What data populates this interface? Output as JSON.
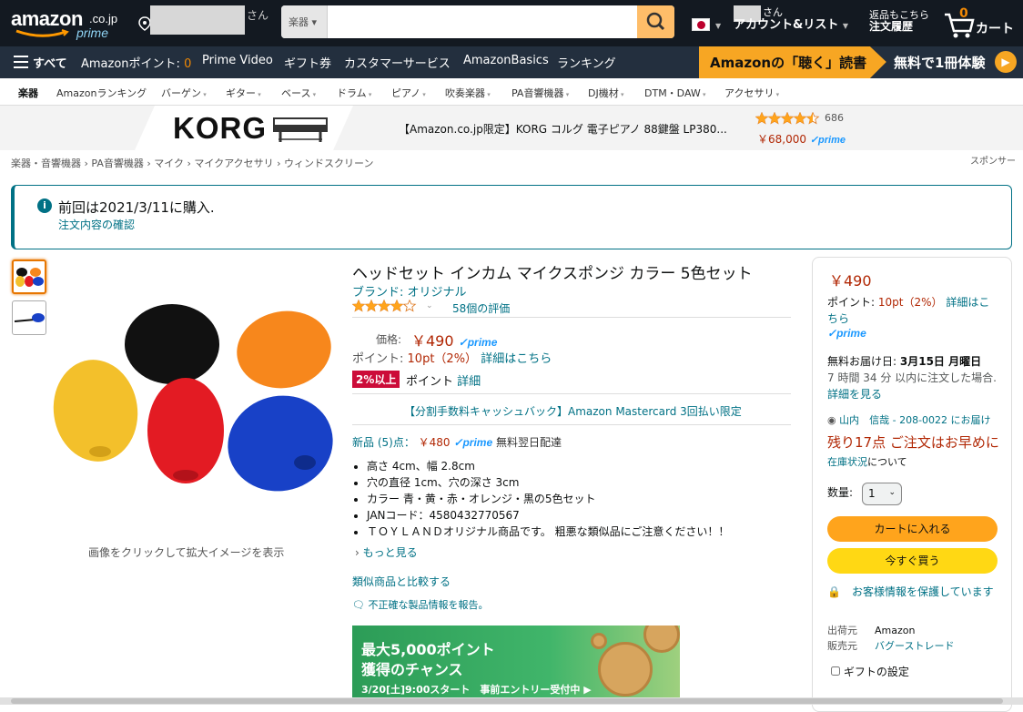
{
  "header": {
    "logo_word": "amazon",
    "logo_domain": ".co.jp",
    "logo_sub": "prime",
    "greeting_suffix": "さん",
    "search_category": "楽器",
    "account_greeting": "さん",
    "account_label": "アカウント&リスト",
    "orders_line1": "返品もこちら",
    "orders_line2": "注文履歴",
    "cart_count": "0",
    "cart_label": "カート"
  },
  "nav": {
    "all": "すべて",
    "points_label": "Amazonポイント:",
    "points_value": "0",
    "items": [
      "Prime Video",
      "ギフト券",
      "カスタマーサービス",
      "AmazonBasics",
      "ランキング"
    ],
    "audible_left": "Amazonの「聴く」読書",
    "audible_right": "無料で1冊体験"
  },
  "subnav": [
    "楽器",
    "Amazonランキング",
    "バーゲン",
    "ギター",
    "ベース",
    "ドラム",
    "ピアノ",
    "吹奏楽器",
    "PA音響機器",
    "DJ機材",
    "DTM・DAW",
    "アクセサリ"
  ],
  "ad": {
    "brand": "KORG",
    "title": "【Amazon.co.jp限定】KORG コルグ 電子ピアノ 88鍵盤 LP380...",
    "reviews": "686",
    "price": "￥68,000",
    "prime": "prime",
    "rating": 4.5
  },
  "breadcrumb": "楽器・音響機器 › PA音響機器 › マイク › マイクアクセサリ › ウィンドスクリーン",
  "sponsor": "スポンサー",
  "notice": {
    "title": "前回は2021/3/11に購入.",
    "link": "注文内容の確認"
  },
  "image_caption": "画像をクリックして拡大イメージを表示",
  "product": {
    "title": "ヘッドセット インカム マイクスポンジ カラー 5色セット",
    "brand": "ブランド: オリジナル",
    "rating": 4.0,
    "ratings_count": "58個の評価",
    "price_label": "価格:",
    "price": "￥490",
    "prime": "prime",
    "points_label": "ポイント:",
    "points_value": "10pt（2%）",
    "points_link": "詳細はこちら",
    "pct_badge": "2%以上",
    "pct_label": "ポイント",
    "pct_link": "詳細",
    "mastercard": "【分割手数料キャッシュバック】Amazon Mastercard 3回払い限定",
    "new_offer_label": "新品 (5)点：",
    "new_offer_price": "￥480",
    "new_offer_shipping": "無料翌日配達",
    "bullets": [
      "高さ 4cm、幅 2.8cm",
      "穴の直径 1cm、穴の深さ 3cm",
      "カラー 青・黄・赤・オレンジ・黒の5色セット",
      "JANコード：4580432770567",
      "ＴＯＹＬＡＮＤオリジナル商品です。 粗悪な類似品にご注意ください！！"
    ],
    "more": "もっと見る",
    "compare": "類似商品と比較する",
    "report": "不正確な製品情報を報告。"
  },
  "promo": {
    "line1": "最大5,000ポイント",
    "line2": "獲得のチャンス",
    "line3": "3/20[土]9:00スタート　事前エントリー受付中 ▶"
  },
  "buybox": {
    "price": "￥490",
    "points_label": "ポイント:",
    "points_value": "10pt（2%）",
    "points_link": "詳細はこちら",
    "prime": "prime",
    "delivery_label": "無料お届け日:",
    "delivery_date": "3月15日 月曜日",
    "order_within": "7 時間 34 分 以内に注文した場合.",
    "details_link": "詳細を見る",
    "ship_to": "山内　信哉 - 208-0022 にお届け",
    "stock": "残り17点 ご注文はお早めに",
    "stock_link": "在庫状況",
    "stock_suffix": "について",
    "qty_label": "数量:",
    "qty_value": "1",
    "add_to_cart": "カートに入れる",
    "buy_now": "今すぐ買う",
    "secure": "お客様情報を保護しています",
    "shipper_label": "出荷元",
    "shipper": "Amazon",
    "seller_label": "販売元",
    "seller": "バグーストレード",
    "gift": "ギフトの設定"
  },
  "colors": {
    "nav_dark": "#131921",
    "nav_main": "#232f3e",
    "price_red": "#b12704",
    "link_teal": "#007185",
    "cart_orange": "#ffa41c",
    "buy_yellow": "#ffd814"
  }
}
